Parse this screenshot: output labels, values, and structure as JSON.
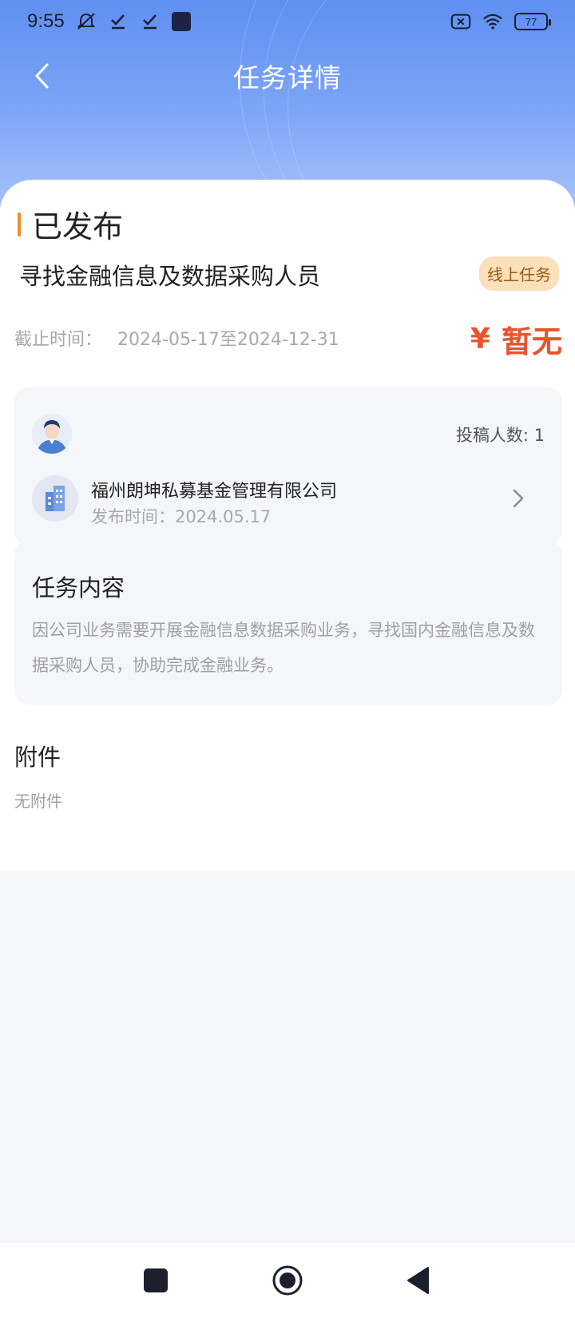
{
  "status_bar": {
    "time": "9:55",
    "battery": "77"
  },
  "nav": {
    "title": "任务详情"
  },
  "task": {
    "status": "已发布",
    "title": "寻找金融信息及数据采购人员",
    "tag": "线上任务",
    "deadline_label": "截止时间：",
    "deadline_value": "2024-05-17至2024-12-31",
    "price_symbol": "¥",
    "price_value": "暂无"
  },
  "publisher": {
    "submit_count_label": "投稿人数: 1",
    "company_name": "福州朗坤私募基金管理有限公司",
    "publish_time": "发布时间：2024.05.17"
  },
  "content": {
    "title": "任务内容",
    "text": "因公司业务需要开展金融信息数据采购业务，寻找国内金融信息及数据采购人员，协助完成金融业务。"
  },
  "attachment": {
    "title": "附件",
    "empty_text": "无附件"
  },
  "colors": {
    "header_start": "#5f8ff2",
    "accent_orange": "#ef8a2d",
    "price_red": "#e9542c",
    "tag_bg": "#fae0bb"
  }
}
